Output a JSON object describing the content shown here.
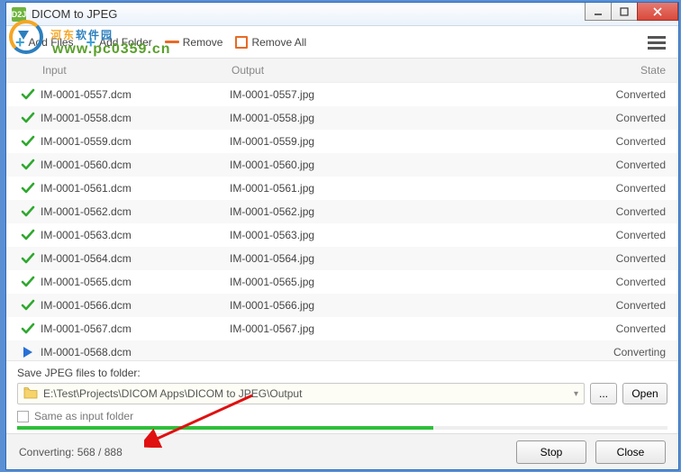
{
  "window": {
    "title": "DICOM to JPEG",
    "app_badge": "D2J"
  },
  "toolbar": {
    "add_files": "Add Files",
    "add_folder": "Add Folder",
    "remove": "Remove",
    "remove_all": "Remove All"
  },
  "watermark": {
    "cn": "河东软件园",
    "url": "www.pc0359.cn"
  },
  "columns": {
    "input": "Input",
    "output": "Output",
    "state": "State"
  },
  "rows": [
    {
      "input": "IM-0001-0557.dcm",
      "output": "IM-0001-0557.jpg",
      "state": "Converted",
      "icon": "check"
    },
    {
      "input": "IM-0001-0558.dcm",
      "output": "IM-0001-0558.jpg",
      "state": "Converted",
      "icon": "check"
    },
    {
      "input": "IM-0001-0559.dcm",
      "output": "IM-0001-0559.jpg",
      "state": "Converted",
      "icon": "check"
    },
    {
      "input": "IM-0001-0560.dcm",
      "output": "IM-0001-0560.jpg",
      "state": "Converted",
      "icon": "check"
    },
    {
      "input": "IM-0001-0561.dcm",
      "output": "IM-0001-0561.jpg",
      "state": "Converted",
      "icon": "check"
    },
    {
      "input": "IM-0001-0562.dcm",
      "output": "IM-0001-0562.jpg",
      "state": "Converted",
      "icon": "check"
    },
    {
      "input": "IM-0001-0563.dcm",
      "output": "IM-0001-0563.jpg",
      "state": "Converted",
      "icon": "check"
    },
    {
      "input": "IM-0001-0564.dcm",
      "output": "IM-0001-0564.jpg",
      "state": "Converted",
      "icon": "check"
    },
    {
      "input": "IM-0001-0565.dcm",
      "output": "IM-0001-0565.jpg",
      "state": "Converted",
      "icon": "check"
    },
    {
      "input": "IM-0001-0566.dcm",
      "output": "IM-0001-0566.jpg",
      "state": "Converted",
      "icon": "check"
    },
    {
      "input": "IM-0001-0567.dcm",
      "output": "IM-0001-0567.jpg",
      "state": "Converted",
      "icon": "check"
    },
    {
      "input": "IM-0001-0568.dcm",
      "output": "",
      "state": "Converting",
      "icon": "play"
    }
  ],
  "save": {
    "label": "Save JPEG files to folder:",
    "path": "E:\\Test\\Projects\\DICOM Apps\\DICOM to JPEG\\Output",
    "browse": "...",
    "open": "Open",
    "same_as": "Same as input folder"
  },
  "footer": {
    "status": "Converting: 568 / 888",
    "stop": "Stop",
    "close": "Close"
  }
}
